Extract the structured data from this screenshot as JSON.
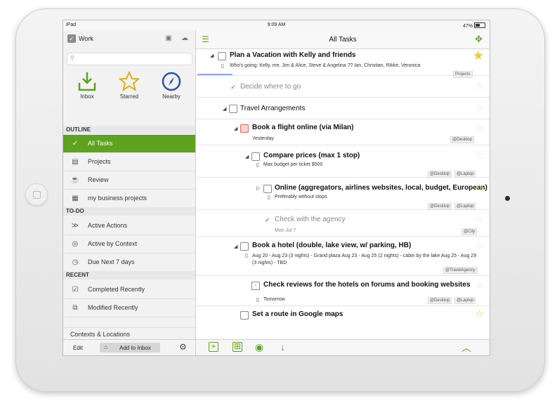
{
  "status_bar": {
    "device": "iPad",
    "time": "9:09 AM",
    "battery": "47%"
  },
  "sidebar": {
    "title": "Work",
    "search_placeholder": "",
    "quick_items": [
      {
        "label": "Inbox"
      },
      {
        "label": "Starred"
      },
      {
        "label": "Nearby"
      }
    ],
    "outline_header": "OUTLINE",
    "outline_items": [
      {
        "label": "All Tasks"
      },
      {
        "label": "Projects"
      },
      {
        "label": "Review"
      },
      {
        "label": "my business projects"
      }
    ],
    "todo_header": "TO-DO",
    "todo_items": [
      {
        "label": "Active Actions"
      },
      {
        "label": "Active by Context"
      },
      {
        "label": "Due Next 7 days"
      }
    ],
    "recent_header": "RECENT",
    "recent_items": [
      {
        "label": "Completed Recently"
      },
      {
        "label": "Modified Recently"
      }
    ],
    "more_item": "Contexts & Locations",
    "footer": {
      "edit": "Edit",
      "add_inbox": "Add to Inbox"
    }
  },
  "main": {
    "title": "All Tasks",
    "tasks": [
      {
        "title": "Plan a Vacation with Kelly and friends",
        "note": "Who's going: Kelly, me, Jim & Alice, Steve & Angelina ?? Ian, Christian, Rikke, Veronica",
        "tag1": "Projects"
      },
      {
        "title": "Decide where to go"
      },
      {
        "title": "Travel Arrangements"
      },
      {
        "title": "Book a flight online (via Milan)",
        "date": "Yesterday",
        "tag1": "@Desktop"
      },
      {
        "title": "Compare prices (max 1 stop)",
        "note": "Max budget per ticket $500",
        "tag1": "@Desktop",
        "tag2": "@Laptop"
      },
      {
        "title": "Online (aggregators, airlines websites, local, budget, European)",
        "note": "Preferably without stops",
        "tag1": "@Desktop",
        "tag2": "@Laptop"
      },
      {
        "title": "Check with the agency",
        "date": "Mon Jul 7",
        "tag1": "@City"
      },
      {
        "title": "Book a hotel (double, lake view, w/ parking, HB)",
        "note": "Aug 20 - Aug 23 (3 nights) - Grand plaza Aug 23 - Aug 25 (2 nights) - cabin by the lake Aug 25 - Aug 29 (3 nights) - TBD",
        "tag1": "@TravelAgency"
      },
      {
        "title": "Check reviews for the hotels on forums and booking websites",
        "date": "Tomorrow",
        "tag1": "@Desktop",
        "tag2": "@Laptop"
      },
      {
        "title": "Set a route in Google maps"
      }
    ]
  }
}
